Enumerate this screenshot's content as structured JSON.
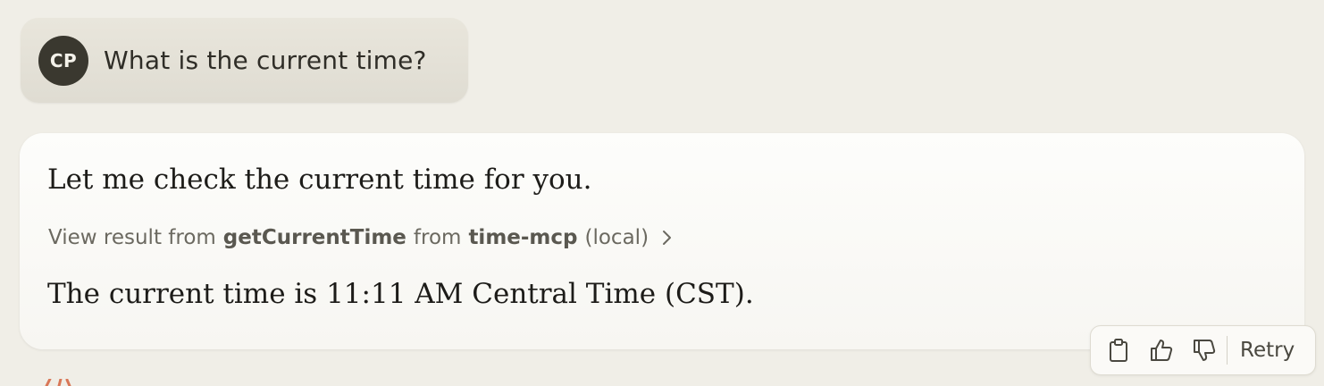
{
  "user_message": {
    "avatar_initials": "CP",
    "text": "What is the current time?"
  },
  "assistant_message": {
    "intro": "Let me check the current time for you.",
    "tool_result": {
      "prefix": "View result from",
      "tool_name": "getCurrentTime",
      "from_word": "from",
      "server_name": "time-mcp",
      "location": "(local)"
    },
    "answer": "The current time is 11:11 AM Central Time (CST)."
  },
  "actions": {
    "icons": [
      "clipboard-icon",
      "thumbs-up-icon",
      "thumbs-down-icon"
    ],
    "retry_label": "Retry"
  },
  "colors": {
    "background": "#f0eee7",
    "avatar": "#3a382f",
    "accent_logo": "#d97757"
  }
}
